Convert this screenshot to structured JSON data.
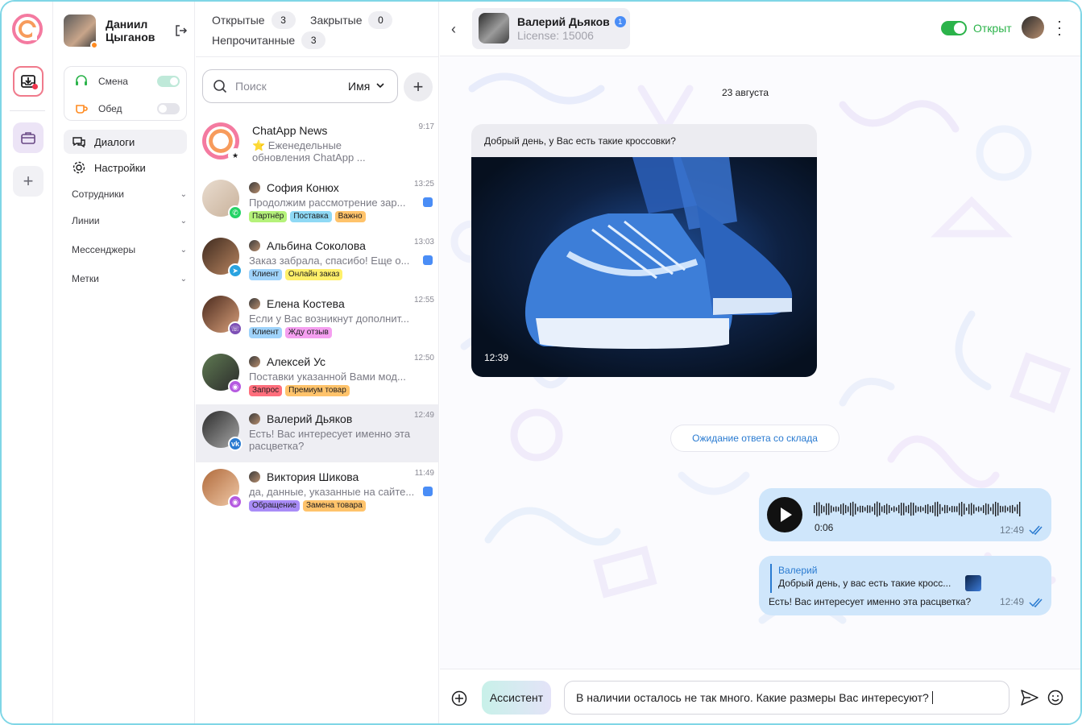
{
  "user": {
    "name_line1": "Даниил",
    "name_line2": "Цыганов"
  },
  "shifts": [
    {
      "label": "Смена",
      "on": true
    },
    {
      "label": "Обед",
      "on": false
    }
  ],
  "menu": {
    "dialogs": "Диалоги",
    "settings": "Настройки",
    "sections": [
      "Сотрудники",
      "Линии",
      "Мессенджеры",
      "Метки"
    ]
  },
  "filters": {
    "open_label": "Открытые",
    "open_count": "3",
    "closed_label": "Закрытые",
    "closed_count": "0",
    "unread_label": "Непрочитанные",
    "unread_count": "3"
  },
  "search": {
    "placeholder": "Поиск",
    "sort_label": "Имя"
  },
  "chats": [
    {
      "name": "ChatApp News",
      "time": "9:17",
      "preview": "⭐ Еженедельные обновления ChatApp ...",
      "tags": [],
      "unread": false
    },
    {
      "name": "София Конюх",
      "time": "13:25",
      "preview": "Продолжим рассмотрение зар...",
      "tags": [
        "Партнёр",
        "Поставка",
        "Важно"
      ],
      "unread": true
    },
    {
      "name": "Альбина Соколова",
      "time": "13:03",
      "preview": "Заказ забрала, спасибо! Еще о...",
      "tags": [
        "Клиент",
        "Онлайн заказ"
      ],
      "unread": true
    },
    {
      "name": "Елена Костева",
      "time": "12:55",
      "preview": "Если у Вас возникнут дополнит...",
      "tags": [
        "Клиент",
        "Жду отзыв"
      ],
      "unread": false
    },
    {
      "name": "Алексей Ус",
      "time": "12:50",
      "preview": "Поставки указанной Вами мод...",
      "tags": [
        "Запрос",
        "Премиум товар"
      ],
      "unread": false
    },
    {
      "name": "Валерий Дьяков",
      "time": "12:49",
      "preview": "Есть! Вас интересует именно эта расцветка?",
      "tags": [],
      "unread": false
    },
    {
      "name": "Виктория Шикова",
      "time": "11:49",
      "preview": "да, данные, указанные на сайте...",
      "tags": [
        "Обращение",
        "Замена товара"
      ],
      "unread": true
    }
  ],
  "tag_colors": {
    "Партнёр": "#b5f27a",
    "Поставка": "#8fd9f5",
    "Важно": "#ffc36b",
    "Клиент": "#9fd3fb",
    "Онлайн заказ": "#fff06a",
    "Жду отзыв": "#f59ff0",
    "Запрос": "#ff6e7c",
    "Премиум товар": "#ffc36b",
    "Обращение": "#a98cf7",
    "Замена товара": "#ffc36b"
  },
  "channel_icons": [
    "star-icon",
    "whatsapp-icon",
    "telegram-icon",
    "viber-icon",
    "chatapp-icon",
    "vk-icon",
    "chatapp-icon"
  ],
  "header": {
    "contact_name": "Валерий Дьяков",
    "contact_count": "1",
    "license": "License: 15006",
    "status_label": "Открыт"
  },
  "messages": {
    "date": "23 августа",
    "incoming_text": "Добрый день, у Вас есть такие кроссовки?",
    "incoming_time": "12:39",
    "system_text": "Ожидание ответа со склада",
    "voice_duration": "0:06",
    "voice_time": "12:49",
    "reply_author": "Валерий",
    "reply_quote": "Добрый день, у вас есть такие кросс...",
    "reply_text": "Есть! Вас интересует именно эта расцветка?",
    "reply_time": "12:49"
  },
  "composer": {
    "assistant_label": "Ассистент",
    "input_text": "В наличии осталось не так много. Какие размеры Вас интересуют?"
  },
  "colors": {
    "accent_blue": "#4a8df6",
    "online_green": "#2bb34a",
    "bubble_out": "#cfe6fb"
  }
}
